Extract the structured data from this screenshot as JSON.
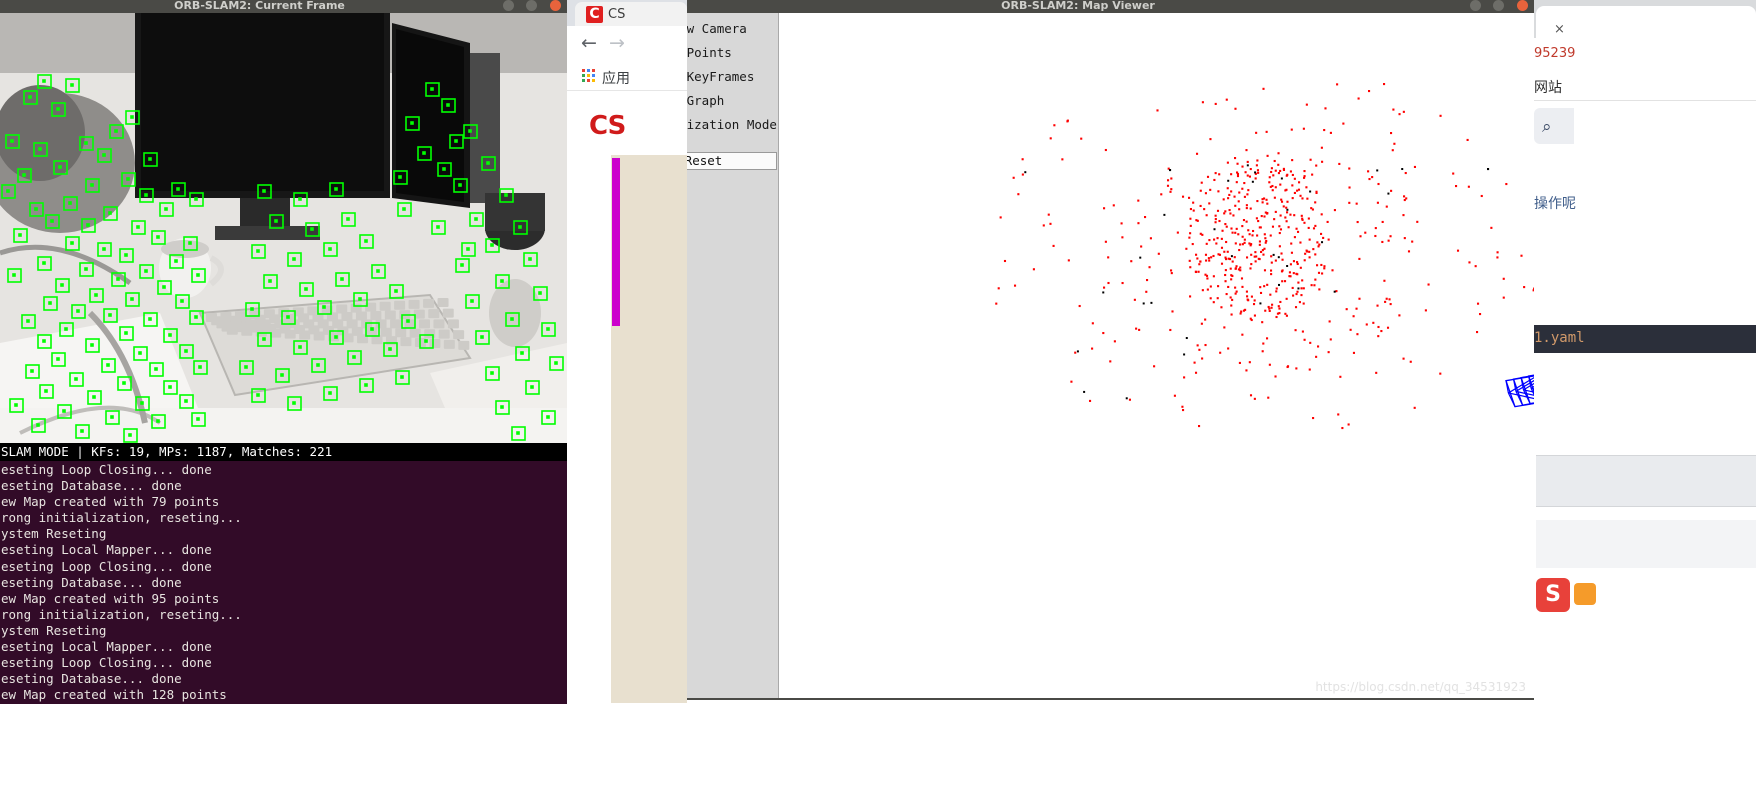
{
  "windows": {
    "current_frame": {
      "title": "ORB-SLAM2: Current Frame",
      "status": "SLAM MODE |  KFs: 19, MPs: 1187, Matches: 221",
      "terminal_lines": [
        "eseting Loop Closing... done",
        "eseting Database... done",
        "ew Map created with 79 points",
        "rong initialization, reseting...",
        "ystem Reseting",
        "eseting Local Mapper... done",
        "eseting Loop Closing... done",
        "eseting Database... done",
        "ew Map created with 95 points",
        "rong initialization, reseting...",
        "ystem Reseting",
        "eseting Local Mapper... done",
        "eseting Loop Closing... done",
        "eseting Database... done",
        "ew Map created with 128 points"
      ]
    },
    "map_viewer": {
      "title": "ORB-SLAM2: Map Viewer",
      "watermark": "https://blog.csdn.net/qq_34531923"
    }
  },
  "panel": {
    "checkboxes": [
      {
        "label": "Follow Camera",
        "checked": true
      },
      {
        "label": "Show Points",
        "checked": true
      },
      {
        "label": "Show KeyFrames",
        "checked": true
      },
      {
        "label": "Show Graph",
        "checked": true
      },
      {
        "label": "Localization Mode",
        "checked": false
      }
    ],
    "reset_label": "Reset"
  },
  "browser_left": {
    "tab_title": "CS",
    "logo_letter": "C",
    "back_icon": "←",
    "forward_icon": "→",
    "apps_label": "应用",
    "brand": "CS"
  },
  "browser_right": {
    "close_icon": "×",
    "url_fragment": "95239",
    "bookmark_label": "网站",
    "search_icon": "⌕",
    "body_text": "操作呢",
    "code_text": "1.yaml",
    "badge_letter": "S"
  },
  "colors": {
    "feature_marker": "#00ff00",
    "map_point": "#ff0000",
    "keyframe": "#0000ff",
    "trajectory": "#00cc00",
    "checkbox_on": "#f7aaa7",
    "terminal_bg": "#320b28",
    "titlebar_bg": "#4a4a46"
  },
  "map_data": {
    "point_cloud_count": 640,
    "keyframe_count": 19
  }
}
